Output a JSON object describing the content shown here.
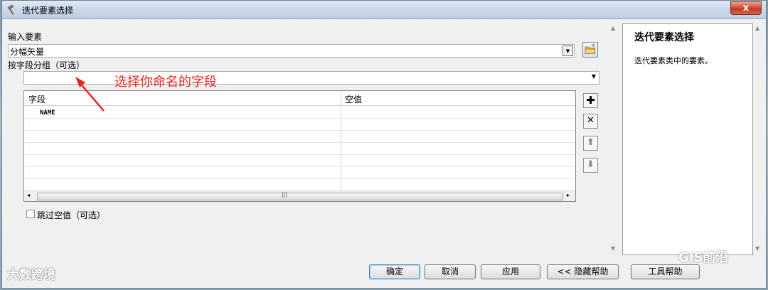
{
  "window": {
    "title": "迭代要素选择",
    "close_label": "x"
  },
  "form": {
    "input_label": "输入要素",
    "input_value": "分幅矢量",
    "group_label": "按字段分组（可选）",
    "group_value": "",
    "table": {
      "headers": [
        "字段",
        "空值"
      ],
      "rows": [
        [
          "NAME",
          ""
        ]
      ]
    },
    "skip_null_label": "跳过空值（可选）",
    "skip_null_checked": false
  },
  "annotation": {
    "text": "选择你命名的字段",
    "color": "#e8261b"
  },
  "side_buttons": [
    {
      "icon": "plus-icon",
      "glyph": "✚"
    },
    {
      "icon": "delete-icon",
      "glyph": "✕"
    },
    {
      "icon": "move-up-icon",
      "glyph": "⬆"
    },
    {
      "icon": "move-down-icon",
      "glyph": "⬇"
    }
  ],
  "help": {
    "title": "迭代要素选择",
    "body": "迭代要素类中的要素。"
  },
  "buttons": {
    "ok": "确定",
    "cancel": "取消",
    "apply": "应用",
    "hide_help": "<< 隐藏帮助",
    "tool_help": "工具帮助"
  },
  "watermarks": {
    "left": "大数跨境",
    "right": "GIS前沿"
  },
  "colors": {
    "accent_red": "#e8261b",
    "titlebar": "#c9d8e8",
    "close": "#c23a22"
  }
}
